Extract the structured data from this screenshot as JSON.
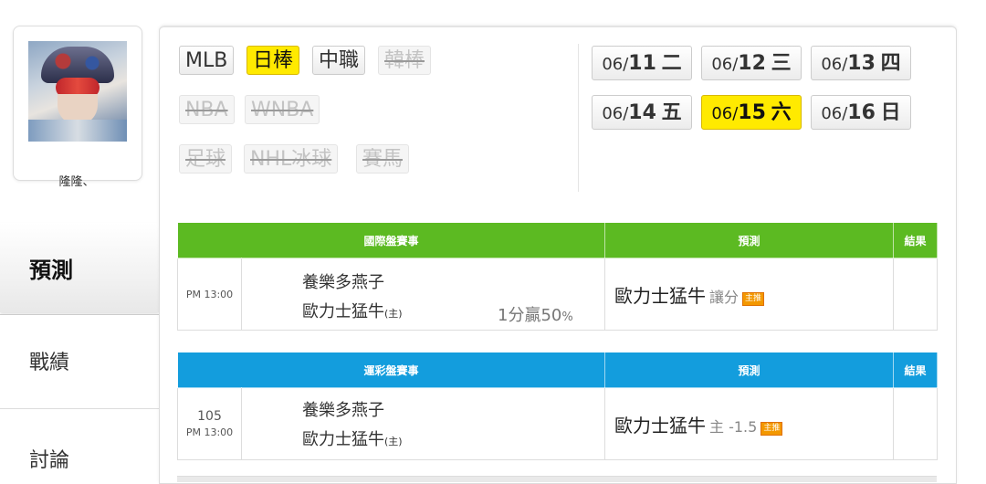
{
  "profile": {
    "username": "隆隆、"
  },
  "nav": {
    "predict": "預測",
    "record": "戰績",
    "discuss": "討論"
  },
  "leagues": [
    "MLB",
    "日棒",
    "中職",
    "韓棒",
    "NBA",
    "WNBA",
    "足球",
    "NHL冰球",
    "賽馬"
  ],
  "active_league": "日棒",
  "dates": [
    {
      "prefix": "06/",
      "day": "11",
      "weekday": "二"
    },
    {
      "prefix": "06/",
      "day": "12",
      "weekday": "三"
    },
    {
      "prefix": "06/",
      "day": "13",
      "weekday": "四"
    },
    {
      "prefix": "06/",
      "day": "14",
      "weekday": "五"
    },
    {
      "prefix": "06/",
      "day": "15",
      "weekday": "六"
    },
    {
      "prefix": "06/",
      "day": "16",
      "weekday": "日"
    }
  ],
  "active_date": "06/15 六",
  "intl_table": {
    "headers": {
      "match": "國際盤賽事",
      "predict": "預測",
      "result": "結果"
    },
    "row": {
      "time": "PM 13:00",
      "team1": "養樂多燕子",
      "team2": "歐力士猛牛",
      "host_mark": "(主)",
      "odds_value": "1分贏50",
      "odds_unit": "%",
      "pick_team": "歐力士猛牛",
      "pick_type": "讓分",
      "badge": "主推",
      "result": ""
    }
  },
  "lottery_table": {
    "headers": {
      "match": "運彩盤賽事",
      "predict": "預測",
      "result": "結果"
    },
    "row": {
      "game_no": "105",
      "time": "PM 13:00",
      "team1": "養樂多燕子",
      "team2": "歐力士猛牛",
      "host_mark": "(主)",
      "pick_team": "歐力士猛牛",
      "pick_type": "主 -1.5",
      "badge": "主推",
      "result": ""
    }
  },
  "colors": {
    "active": "#ffea00",
    "intl_header": "#5cba22",
    "lottery_header": "#139ddd",
    "badge": "#f39800"
  }
}
